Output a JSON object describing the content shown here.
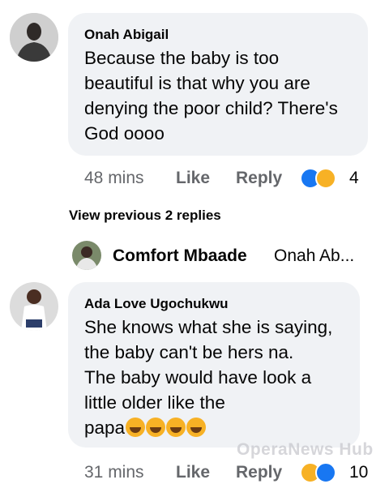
{
  "comments": [
    {
      "author": "Onah Abigail",
      "text_lines": [
        "Because the baby is too",
        "beautiful is that why you are",
        "denying the poor child? There's",
        "God oooo"
      ],
      "time": "48 mins",
      "like_label": "Like",
      "reply_label": "Reply",
      "reaction_count": "4"
    },
    {
      "author": "Ada Love Ugochukwu",
      "text_lines": [
        "She knows what she is saying,",
        "the baby can't be hers na.",
        "The baby would have look a",
        "little older like the",
        "papa"
      ],
      "time": "31 mins",
      "like_label": "Like",
      "reply_label": "Reply",
      "reaction_count": "10"
    }
  ],
  "replies_link": "View previous 2 replies",
  "reply_preview": {
    "author": "Comfort Mbaade",
    "snippet": "Onah Ab..."
  },
  "watermark": "OperaNews Hub",
  "colors": {
    "bubble": "#f0f2f5",
    "meta_text": "#65676b",
    "like_blue": "#1877f2",
    "haha_yellow": "#f7b125"
  },
  "icons": [
    "like-reaction-icon",
    "haha-reaction-icon",
    "laughing-emoji-icon"
  ]
}
